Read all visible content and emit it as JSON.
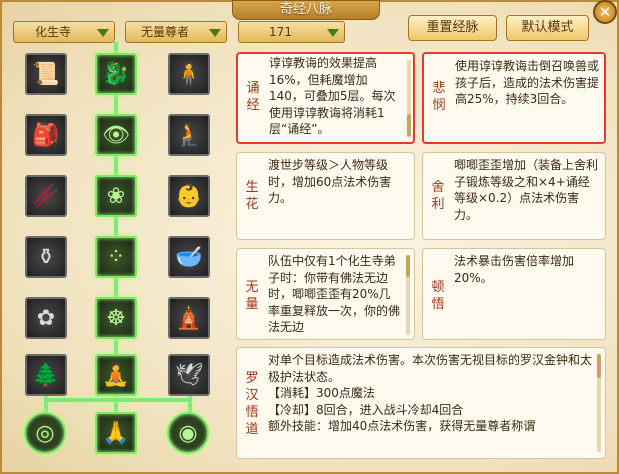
{
  "window": {
    "title": "奇经八脉",
    "close_icon": "close-icon"
  },
  "dropdowns": [
    {
      "value": "化生寺"
    },
    {
      "value": "无量尊者"
    },
    {
      "value": "171"
    }
  ],
  "buttons": {
    "reset": "重置经脉",
    "default": "默认模式"
  },
  "skills": {
    "left": [
      "scroll-icon",
      "armor-icon",
      "staff-icon",
      "gourd-icon",
      "lotus-icon",
      "tree-icon",
      "spiral-icon"
    ],
    "center": [
      "dragon-icon",
      "eye-icon",
      "flower-icon",
      "beads-icon",
      "buddha-aura-icon",
      "meditating-monk-icon",
      "seated-monk-icon"
    ],
    "right": [
      "monk-icon",
      "kneeling-monk-icon",
      "child-monk-icon",
      "bowl-icon",
      "pagoda-icon",
      "crane-icon",
      "swirl-icon"
    ]
  },
  "panels": {
    "songjing": {
      "title": "诵经",
      "text": "谆谆教诲的效果提高16%，但耗魔增加140，可叠加5层。每次使用谆谆教诲将消耗1层“诵经”。"
    },
    "beimin": {
      "title": "悲悯",
      "text": "使用谆谆教诲击倒召唤兽或孩子后，造成的法术伤害提高25%，持续3回合。"
    },
    "shenghua": {
      "title": "生花",
      "text": "渡世步等级＞人物等级时，增加60点法术伤害力。"
    },
    "sheli": {
      "title": "舍利",
      "text": "唧唧歪歪增加（装备上舍利子锻炼等级之和×4+诵经等级×0.2）点法术伤害力。"
    },
    "wuliang": {
      "title": "无量",
      "text": "队伍中仅有1个化生寺弟子时：你带有佛法无边时，唧唧歪歪有20%几率重复释放一次，你的佛法无边"
    },
    "dunwu": {
      "title": "顿悟",
      "text": "法术暴击伤害倍率增加20%。"
    },
    "luohan": {
      "title": "罗汉悟道",
      "lines": [
        "对单个目标造成法术伤害。本次伤害无视目标的罗汉金钟和太极护法状态。",
        "【消耗】300点魔法",
        "【冷却】8回合，进入战斗冷却4回合",
        "额外技能：增加40点法术伤害，获得无量尊者称谓"
      ]
    }
  }
}
